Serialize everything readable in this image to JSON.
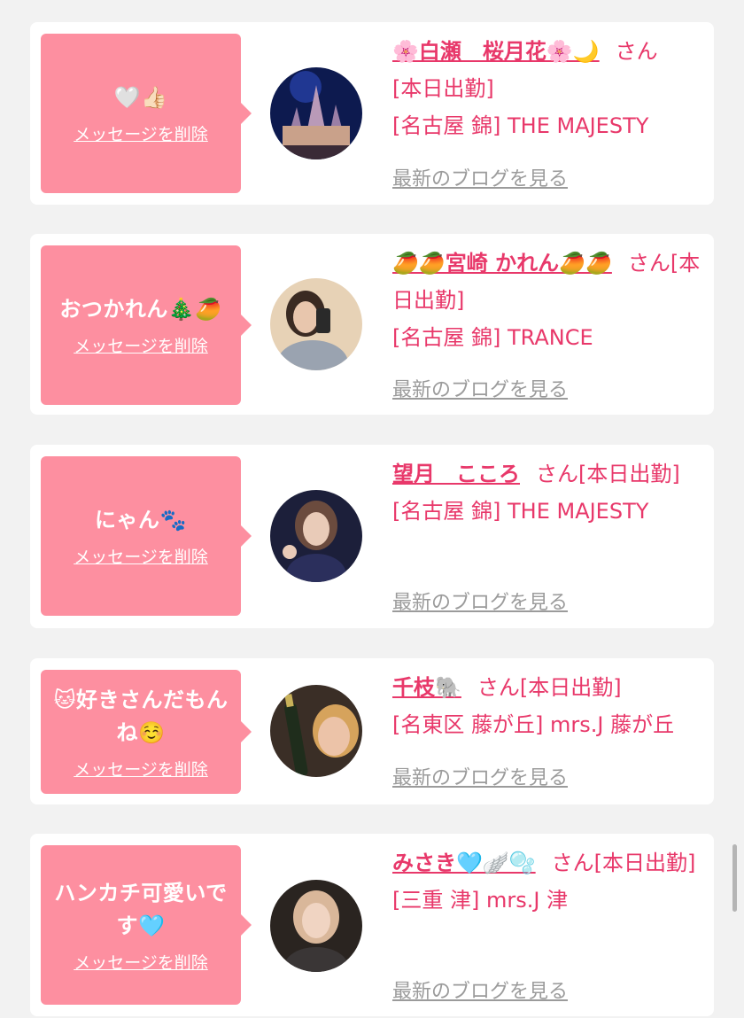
{
  "colors": {
    "background": "#f2f2f2",
    "bubble": "#fd8fa0",
    "accent": "#e8386a",
    "link_gray": "#9b9b9b"
  },
  "cards": [
    {
      "message": "🤍👍🏻",
      "delete_label": "メッセージを削除",
      "name": "🌸白瀬　桜月花🌸🌙",
      "honorific": "さん",
      "status": "[本日出勤]",
      "store": "[名古屋 錦] THE MAJESTY",
      "blog_label": "最新のブログを見る",
      "avatar_icon": "castle-night-photo"
    },
    {
      "message": "おつかれん🎄🥭",
      "delete_label": "メッセージを削除",
      "name": "🥭🥭宮崎 かれん🥭🥭",
      "honorific": "さん",
      "status": "[本日出勤]",
      "store": "[名古屋 錦] TRANCE",
      "blog_label": "最新のブログを見る",
      "avatar_icon": "mirror-selfie-photo"
    },
    {
      "message": "にゃん🐾",
      "delete_label": "メッセージを削除",
      "name": "望月　こころ",
      "honorific": "さん",
      "status": "[本日出勤]",
      "store": "[名古屋 錦] THE MAJESTY",
      "blog_label": "最新のブログを見る",
      "avatar_icon": "portrait-photo"
    },
    {
      "message": "🐱好きさんだもんね☺️",
      "delete_label": "メッセージを削除",
      "name": "千枝🐘",
      "honorific": "さん",
      "status": "[本日出勤]",
      "store": "[名東区 藤が丘] mrs.J 藤が丘",
      "blog_label": "最新のブログを見る",
      "avatar_icon": "champagne-photo"
    },
    {
      "message": "ハンカチ可愛いです🩵",
      "delete_label": "メッセージを削除",
      "name": "みさき🩵🪽🫧",
      "honorific": "さん",
      "status": "[本日出勤]",
      "store": "[三重 津] mrs.J 津",
      "blog_label": "最新のブログを見る",
      "avatar_icon": "portrait-photo"
    }
  ]
}
